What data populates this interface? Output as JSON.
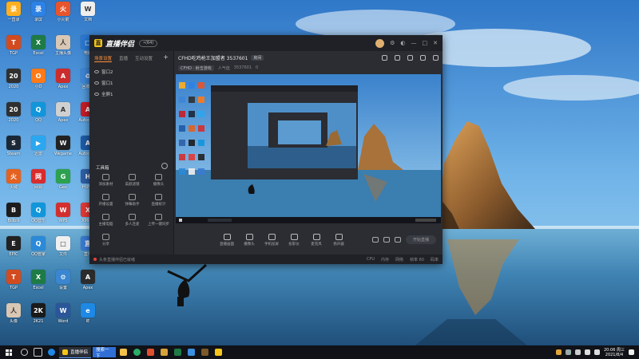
{
  "desktop": {
    "icons": [
      {
        "label": "一直录",
        "color": "#ffb020",
        "glyph": "录"
      },
      {
        "label": "录屏",
        "color": "#2d82e6",
        "glyph": "录"
      },
      {
        "label": "小火箭",
        "color": "#e8552c",
        "glyph": "火"
      },
      {
        "label": "文档",
        "color": "#eeeeee",
        "glyph": "W"
      },
      {
        "label": "TGP",
        "color": "#d24b1f",
        "glyph": "T"
      },
      {
        "label": "Excel",
        "color": "#1e7b45",
        "glyph": "X"
      },
      {
        "label": "主播头像",
        "color": "#d9c7b4",
        "glyph": "人"
      },
      {
        "label": "电脑",
        "color": "#2a78d4",
        "glyph": "□"
      },
      {
        "label": "2020",
        "color": "#303030",
        "glyph": "20"
      },
      {
        "label": "小O",
        "color": "#ff7a18",
        "glyph": "O"
      },
      {
        "label": "Apex",
        "color": "#cc2c2c",
        "glyph": "A"
      },
      {
        "label": "回收站",
        "color": "#3f86d8",
        "glyph": "♻"
      },
      {
        "label": "2020",
        "color": "#303030",
        "glyph": "20"
      },
      {
        "label": "QQ",
        "color": "#1296db",
        "glyph": "Q"
      },
      {
        "label": "Apex",
        "color": "#d0d0d0",
        "glyph": "A"
      },
      {
        "label": "Autodesk",
        "color": "#c81d25",
        "glyph": "A"
      },
      {
        "label": "Steam",
        "color": "#1b2838",
        "glyph": "S"
      },
      {
        "label": "迅雷",
        "color": "#2aa7ef",
        "glyph": "▶"
      },
      {
        "label": "Wegame",
        "color": "#222222",
        "glyph": "W"
      },
      {
        "label": "Autodesk",
        "color": "#1e5ba8",
        "glyph": "A"
      },
      {
        "label": "火绒",
        "color": "#e4611f",
        "glyph": "火"
      },
      {
        "label": "网易",
        "color": "#d92c2c",
        "glyph": "网"
      },
      {
        "label": "Geo",
        "color": "#2da14e",
        "glyph": "G"
      },
      {
        "label": "HUNT",
        "color": "#2f5fa8",
        "glyph": "H"
      },
      {
        "label": "Bilibili",
        "color": "#1c1c1c",
        "glyph": "B"
      },
      {
        "label": "QQ音乐",
        "color": "#1296db",
        "glyph": "Q"
      },
      {
        "label": "WPS",
        "color": "#d32f2f",
        "glyph": "W"
      },
      {
        "label": "XMind",
        "color": "#e53935",
        "glyph": "X"
      },
      {
        "label": "EPIC",
        "color": "#222222",
        "glyph": "E"
      },
      {
        "label": "QQ管家",
        "color": "#2b8ad8",
        "glyph": "Q"
      },
      {
        "label": "文件",
        "color": "#f0f0f0",
        "glyph": "□"
      },
      {
        "label": "直播",
        "color": "#3a7bd5",
        "glyph": "直"
      },
      {
        "label": "TGP",
        "color": "#d24b1f",
        "glyph": "T"
      },
      {
        "label": "Excel",
        "color": "#1e7b45",
        "glyph": "X"
      },
      {
        "label": "设置",
        "color": "#3a86d0",
        "glyph": "⚙"
      },
      {
        "label": "Apex",
        "color": "#2c2c2c",
        "glyph": "A"
      },
      {
        "label": "头像",
        "color": "#d9c7b4",
        "glyph": "人"
      },
      {
        "label": "2K21",
        "color": "#1a1a1a",
        "glyph": "2K"
      },
      {
        "label": "Word",
        "color": "#2b579a",
        "glyph": "W"
      },
      {
        "label": "IE",
        "color": "#1e88e5",
        "glyph": "e"
      }
    ]
  },
  "window": {
    "app_name": "直播伴侣",
    "version": "•(64)",
    "controls": {
      "settings": "⚙",
      "skin": "◐",
      "min": "—",
      "max": "□",
      "close": "✕"
    }
  },
  "sidebar": {
    "tabs": [
      "场景设置",
      "直播",
      "互动设置"
    ],
    "add": "+",
    "scenes": [
      "窗口2",
      "窗口1",
      "全屏1"
    ],
    "tools_title": "工具箱",
    "tools": [
      "添加素材",
      "美颜滤镜",
      "摄像头",
      "开播设置",
      "弹幕助手",
      "直播统计",
      "主播电脑",
      "多人连麦",
      "上传一键同步",
      "分享"
    ]
  },
  "main": {
    "room_title": "CFHD吃鸡枪王加盟者 3537601",
    "room_tag": "房间",
    "meta": [
      "CFHD · 射击游戏",
      "人气值",
      "3537601",
      "0"
    ],
    "controls": [
      "直播画面",
      "摄像头",
      "手机投屏",
      "投影仪",
      "麦克风",
      "扬声器"
    ],
    "live_button": "开始直播"
  },
  "statusbar": {
    "left": "头条直播伴侣已就绪",
    "right": [
      "CPU",
      "内存",
      "网络",
      "帧率 60",
      "码率"
    ]
  },
  "taskbar": {
    "app_title": "直播伴侣",
    "search_label": "搜索一下",
    "time": "20:06 周三",
    "date": "2021/8/4",
    "colors": {
      "accent": "#5aa0ff"
    }
  }
}
